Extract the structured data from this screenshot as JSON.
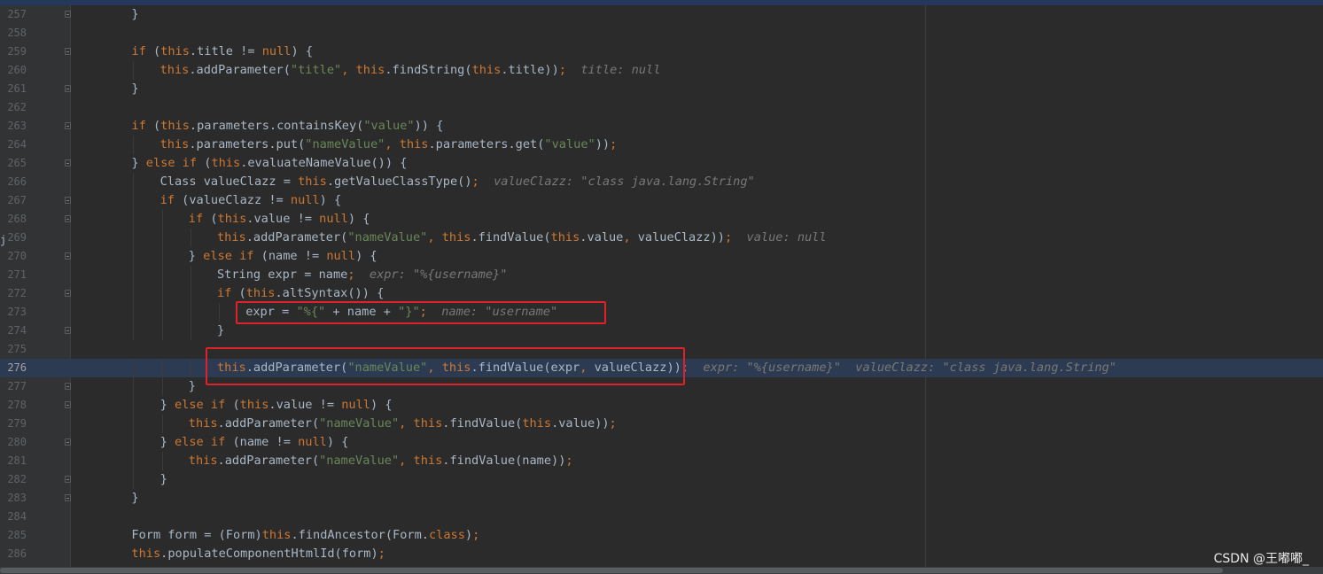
{
  "editor": {
    "current_line": "276",
    "watermark": "CSDN @王嘟嘟_",
    "colors": {
      "background": "#2b2b2b",
      "gutter": "#313335",
      "keyword": "#cc7832",
      "string": "#6a8759",
      "identifier": "#a9b7c6",
      "inlay_hint": "#787878",
      "current_line": "#2d3b52",
      "annotation_box": "#e0202a"
    },
    "lines": [
      {
        "num": "257",
        "indent": 2,
        "fold": true,
        "tokens": [
          {
            "t": "}",
            "c": "p"
          }
        ]
      },
      {
        "num": "258",
        "indent": 0,
        "fold": false,
        "tokens": []
      },
      {
        "num": "259",
        "indent": 2,
        "fold": true,
        "tokens": [
          {
            "t": "if",
            "c": "kw"
          },
          {
            "t": " (",
            "c": "p"
          },
          {
            "t": "this",
            "c": "kw"
          },
          {
            "t": ".title != ",
            "c": "p"
          },
          {
            "t": "null",
            "c": "kw"
          },
          {
            "t": ") {",
            "c": "p"
          }
        ]
      },
      {
        "num": "260",
        "indent": 3,
        "fold": false,
        "tokens": [
          {
            "t": "this",
            "c": "kw"
          },
          {
            "t": ".addParameter(",
            "c": "p"
          },
          {
            "t": "\"title\"",
            "c": "str"
          },
          {
            "t": ", ",
            "c": "kw"
          },
          {
            "t": "this",
            "c": "kw"
          },
          {
            "t": ".findString(",
            "c": "p"
          },
          {
            "t": "this",
            "c": "kw"
          },
          {
            "t": ".title))",
            "c": "p"
          },
          {
            "t": ";",
            "c": "kw"
          },
          {
            "t": "  title: null",
            "c": "hint"
          }
        ]
      },
      {
        "num": "261",
        "indent": 2,
        "fold": true,
        "tokens": [
          {
            "t": "}",
            "c": "p"
          }
        ]
      },
      {
        "num": "262",
        "indent": 0,
        "fold": false,
        "tokens": []
      },
      {
        "num": "263",
        "indent": 2,
        "fold": true,
        "tokens": [
          {
            "t": "if",
            "c": "kw"
          },
          {
            "t": " (",
            "c": "p"
          },
          {
            "t": "this",
            "c": "kw"
          },
          {
            "t": ".parameters.containsKey(",
            "c": "p"
          },
          {
            "t": "\"value\"",
            "c": "str"
          },
          {
            "t": ")) {",
            "c": "p"
          }
        ]
      },
      {
        "num": "264",
        "indent": 3,
        "fold": false,
        "tokens": [
          {
            "t": "this",
            "c": "kw"
          },
          {
            "t": ".parameters.put(",
            "c": "p"
          },
          {
            "t": "\"nameValue\"",
            "c": "str"
          },
          {
            "t": ", ",
            "c": "kw"
          },
          {
            "t": "this",
            "c": "kw"
          },
          {
            "t": ".parameters.get(",
            "c": "p"
          },
          {
            "t": "\"value\"",
            "c": "str"
          },
          {
            "t": "))",
            "c": "p"
          },
          {
            "t": ";",
            "c": "kw"
          }
        ]
      },
      {
        "num": "265",
        "indent": 2,
        "fold": true,
        "tokens": [
          {
            "t": "} ",
            "c": "p"
          },
          {
            "t": "else if",
            "c": "kw"
          },
          {
            "t": " (",
            "c": "p"
          },
          {
            "t": "this",
            "c": "kw"
          },
          {
            "t": ".evaluateNameValue()) {",
            "c": "p"
          }
        ]
      },
      {
        "num": "266",
        "indent": 3,
        "fold": false,
        "tokens": [
          {
            "t": "Class valueClazz = ",
            "c": "p"
          },
          {
            "t": "this",
            "c": "kw"
          },
          {
            "t": ".getValueClassType()",
            "c": "p"
          },
          {
            "t": ";",
            "c": "kw"
          },
          {
            "t": "  valueClazz: \"class java.lang.String\"",
            "c": "hint"
          }
        ]
      },
      {
        "num": "267",
        "indent": 3,
        "fold": true,
        "tokens": [
          {
            "t": "if",
            "c": "kw"
          },
          {
            "t": " (valueClazz != ",
            "c": "p"
          },
          {
            "t": "null",
            "c": "kw"
          },
          {
            "t": ") {",
            "c": "p"
          }
        ]
      },
      {
        "num": "268",
        "indent": 4,
        "fold": true,
        "tokens": [
          {
            "t": "if",
            "c": "kw"
          },
          {
            "t": " (",
            "c": "p"
          },
          {
            "t": "this",
            "c": "kw"
          },
          {
            "t": ".value != ",
            "c": "p"
          },
          {
            "t": "null",
            "c": "kw"
          },
          {
            "t": ") {",
            "c": "p"
          }
        ]
      },
      {
        "num": "269",
        "indent": 5,
        "fold": false,
        "tokens": [
          {
            "t": "this",
            "c": "kw"
          },
          {
            "t": ".addParameter(",
            "c": "p"
          },
          {
            "t": "\"nameValue\"",
            "c": "str"
          },
          {
            "t": ", ",
            "c": "kw"
          },
          {
            "t": "this",
            "c": "kw"
          },
          {
            "t": ".findValue(",
            "c": "p"
          },
          {
            "t": "this",
            "c": "kw"
          },
          {
            "t": ".value",
            "c": "p"
          },
          {
            "t": ", ",
            "c": "kw"
          },
          {
            "t": "valueClazz))",
            "c": "p"
          },
          {
            "t": ";",
            "c": "kw"
          },
          {
            "t": "  value: null",
            "c": "hint"
          }
        ]
      },
      {
        "num": "270",
        "indent": 4,
        "fold": true,
        "tokens": [
          {
            "t": "} ",
            "c": "p"
          },
          {
            "t": "else if",
            "c": "kw"
          },
          {
            "t": " (name != ",
            "c": "p"
          },
          {
            "t": "null",
            "c": "kw"
          },
          {
            "t": ") {",
            "c": "p"
          }
        ]
      },
      {
        "num": "271",
        "indent": 5,
        "fold": false,
        "tokens": [
          {
            "t": "String expr = name",
            "c": "p"
          },
          {
            "t": ";",
            "c": "kw"
          },
          {
            "t": "  expr: \"%{username}\"",
            "c": "hint"
          }
        ]
      },
      {
        "num": "272",
        "indent": 5,
        "fold": true,
        "tokens": [
          {
            "t": "if",
            "c": "kw"
          },
          {
            "t": " (",
            "c": "p"
          },
          {
            "t": "this",
            "c": "kw"
          },
          {
            "t": ".altSyntax()) {",
            "c": "p"
          }
        ]
      },
      {
        "num": "273",
        "indent": 6,
        "fold": false,
        "tokens": [
          {
            "t": "expr = ",
            "c": "p"
          },
          {
            "t": "\"%{\"",
            "c": "str"
          },
          {
            "t": " + name + ",
            "c": "p"
          },
          {
            "t": "\"}\"",
            "c": "str"
          },
          {
            "t": ";",
            "c": "kw"
          },
          {
            "t": "  name: \"username\"",
            "c": "hint"
          }
        ]
      },
      {
        "num": "274",
        "indent": 5,
        "fold": true,
        "tokens": [
          {
            "t": "}",
            "c": "p"
          }
        ]
      },
      {
        "num": "275",
        "indent": 0,
        "fold": false,
        "tokens": []
      },
      {
        "num": "276",
        "indent": 5,
        "fold": false,
        "current": true,
        "tokens": [
          {
            "t": "this",
            "c": "kw"
          },
          {
            "t": ".addParameter(",
            "c": "p"
          },
          {
            "t": "\"nameValue\"",
            "c": "str"
          },
          {
            "t": ", ",
            "c": "kw"
          },
          {
            "t": "this",
            "c": "kw"
          },
          {
            "t": ".findValue(expr",
            "c": "p"
          },
          {
            "t": ", ",
            "c": "kw"
          },
          {
            "t": "valueClazz))",
            "c": "p"
          },
          {
            "t": ";",
            "c": "kw"
          },
          {
            "t": "  expr: \"%{username}\"  valueClazz: \"class java.lang.String\"",
            "c": "hint"
          }
        ]
      },
      {
        "num": "277",
        "indent": 4,
        "fold": true,
        "tokens": [
          {
            "t": "}",
            "c": "p"
          }
        ]
      },
      {
        "num": "278",
        "indent": 3,
        "fold": true,
        "tokens": [
          {
            "t": "} ",
            "c": "p"
          },
          {
            "t": "else if",
            "c": "kw"
          },
          {
            "t": " (",
            "c": "p"
          },
          {
            "t": "this",
            "c": "kw"
          },
          {
            "t": ".value != ",
            "c": "p"
          },
          {
            "t": "null",
            "c": "kw"
          },
          {
            "t": ") {",
            "c": "p"
          }
        ]
      },
      {
        "num": "279",
        "indent": 4,
        "fold": false,
        "tokens": [
          {
            "t": "this",
            "c": "kw"
          },
          {
            "t": ".addParameter(",
            "c": "p"
          },
          {
            "t": "\"nameValue\"",
            "c": "str"
          },
          {
            "t": ", ",
            "c": "kw"
          },
          {
            "t": "this",
            "c": "kw"
          },
          {
            "t": ".findValue(",
            "c": "p"
          },
          {
            "t": "this",
            "c": "kw"
          },
          {
            "t": ".value))",
            "c": "p"
          },
          {
            "t": ";",
            "c": "kw"
          }
        ]
      },
      {
        "num": "280",
        "indent": 3,
        "fold": true,
        "tokens": [
          {
            "t": "} ",
            "c": "p"
          },
          {
            "t": "else if",
            "c": "kw"
          },
          {
            "t": " (name != ",
            "c": "p"
          },
          {
            "t": "null",
            "c": "kw"
          },
          {
            "t": ") {",
            "c": "p"
          }
        ]
      },
      {
        "num": "281",
        "indent": 4,
        "fold": false,
        "tokens": [
          {
            "t": "this",
            "c": "kw"
          },
          {
            "t": ".addParameter(",
            "c": "p"
          },
          {
            "t": "\"nameValue\"",
            "c": "str"
          },
          {
            "t": ", ",
            "c": "kw"
          },
          {
            "t": "this",
            "c": "kw"
          },
          {
            "t": ".findValue(name))",
            "c": "p"
          },
          {
            "t": ";",
            "c": "kw"
          }
        ]
      },
      {
        "num": "282",
        "indent": 3,
        "fold": true,
        "tokens": [
          {
            "t": "}",
            "c": "p"
          }
        ]
      },
      {
        "num": "283",
        "indent": 2,
        "fold": true,
        "tokens": [
          {
            "t": "}",
            "c": "p"
          }
        ]
      },
      {
        "num": "284",
        "indent": 0,
        "fold": false,
        "tokens": []
      },
      {
        "num": "285",
        "indent": 2,
        "fold": false,
        "tokens": [
          {
            "t": "Form form = (Form)",
            "c": "p"
          },
          {
            "t": "this",
            "c": "kw"
          },
          {
            "t": ".findAncestor(Form.",
            "c": "p"
          },
          {
            "t": "class",
            "c": "kw"
          },
          {
            "t": ")",
            "c": "p"
          },
          {
            "t": ";",
            "c": "kw"
          }
        ]
      },
      {
        "num": "286",
        "indent": 2,
        "fold": false,
        "tokens": [
          {
            "t": "this",
            "c": "kw"
          },
          {
            "t": ".populateComponentHtmlId(form)",
            "c": "p"
          },
          {
            "t": ";",
            "c": "kw"
          }
        ]
      }
    ]
  }
}
